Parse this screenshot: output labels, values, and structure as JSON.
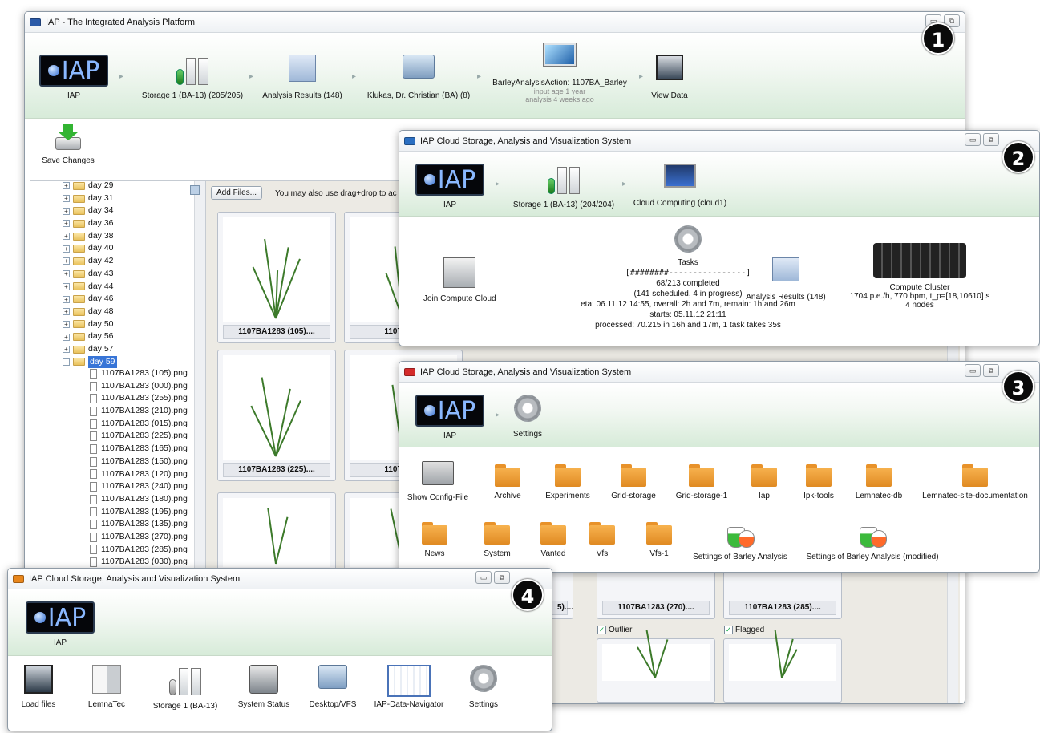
{
  "w1": {
    "title": "IAP - The Integrated Analysis Platform",
    "icon_color": "#2b5aa8",
    "nav": [
      {
        "label": "IAP"
      },
      {
        "label": "Storage 1 (BA-13) (205/205)"
      },
      {
        "label": "Analysis Results (148)"
      },
      {
        "label": "Klukas, Dr. Christian (BA) (8)"
      },
      {
        "label": "BarleyAnalysisAction: 1107BA_Barley",
        "sub1": "input age 1 year",
        "sub2": "analysis 4 weeks ago"
      },
      {
        "label": "View Data"
      }
    ],
    "save_label": "Save Changes",
    "add_files": "Add Files...",
    "drag_hint": "You may also use drag+drop to ac",
    "days": [
      "day 29",
      "day 31",
      "day 34",
      "day 36",
      "day 38",
      "day 40",
      "day 42",
      "day 43",
      "day 44",
      "day 46",
      "day 48",
      "day 50",
      "day 56",
      "day 57",
      "day 59"
    ],
    "files": [
      "1107BA1283 (105).png",
      "1107BA1283 (000).png",
      "1107BA1283 (255).png",
      "1107BA1283 (210).png",
      "1107BA1283 (015).png",
      "1107BA1283 (225).png",
      "1107BA1283 (165).png",
      "1107BA1283 (150).png",
      "1107BA1283 (120).png",
      "1107BA1283 (240).png",
      "1107BA1283 (180).png",
      "1107BA1283 (195).png",
      "1107BA1283 (135).png",
      "1107BA1283 (270).png",
      "1107BA1283 (285).png",
      "1107BA1283 (030).png"
    ],
    "thumbs": [
      "1107BA1283 (105)....",
      "1107BA12",
      "1107BA1283 (225)....",
      "1107BA12"
    ],
    "thumbs_lower": [
      "5)....",
      "1107BA1283 (270)....",
      "1107BA1283 (285)...."
    ],
    "outlier": "Outlier",
    "flagged": "Flagged"
  },
  "w2": {
    "title": "IAP Cloud Storage, Analysis and Visualization System",
    "icon_color": "#2b6fc2",
    "nav": [
      {
        "label": "IAP"
      },
      {
        "label": "Storage 1 (BA-13) (204/204)"
      },
      {
        "label": "Cloud Computing (cloud1)"
      }
    ],
    "join": "Join Compute Cloud",
    "tasks": {
      "title": "Tasks",
      "bar": "[########----------------]",
      "completed": "68/213 completed",
      "scheduled": "(141 scheduled, 4 in progress)",
      "eta": "eta: 06.11.12 14:55, overall: 2h and 7m, remain: 1h and 26m",
      "starts": "starts: 05.11.12 21:11",
      "processed": "processed: 70.215 in 16h and 17m, 1 task takes 35s"
    },
    "results": "Analysis Results (148)",
    "cluster": {
      "title": "Compute Cluster",
      "stats": "1704 p.e./h, 770 bpm, t_p=[18,10610] s",
      "nodes": "4 nodes"
    }
  },
  "w3": {
    "title": "IAP Cloud Storage, Analysis and Visualization System",
    "icon_color": "#d42a2a",
    "nav": [
      {
        "label": "IAP"
      },
      {
        "label": "Settings"
      }
    ],
    "row1": [
      "Show Config-File",
      "Archive",
      "Experiments",
      "Grid-storage",
      "Grid-storage-1",
      "Iap",
      "Ipk-tools",
      "Lemnatec-db",
      "Lemnatec-site-documentation"
    ],
    "row2": [
      "News",
      "System",
      "Vanted",
      "Vfs",
      "Vfs-1",
      "Settings of Barley Analysis",
      "Settings of Barley Analysis (modified)"
    ]
  },
  "w4": {
    "title": "IAP Cloud Storage, Analysis and Visualization System",
    "icon_color": "#e8861c",
    "nav": [
      {
        "label": "IAP"
      }
    ],
    "items": [
      "Load files",
      "LemnaTec",
      "Storage 1 (BA-13)",
      "System Status",
      "Desktop/VFS",
      "IAP-Data-Navigator",
      "Settings"
    ]
  },
  "badges": [
    "1",
    "2",
    "3",
    "4"
  ],
  "window_controls": {
    "minimize": "▭",
    "restore": "⧉"
  }
}
